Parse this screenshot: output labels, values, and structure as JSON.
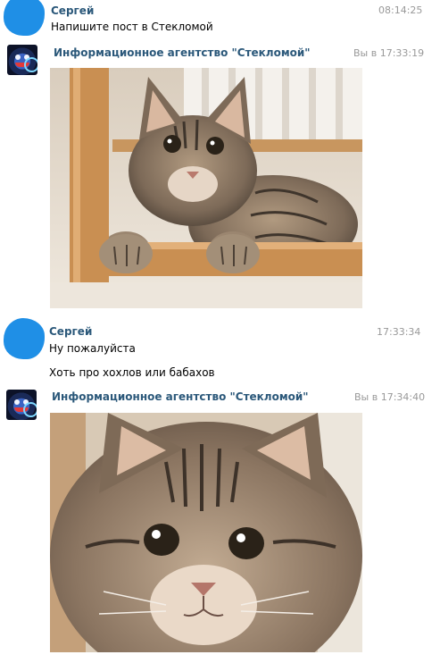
{
  "messages": [
    {
      "author": "Сергей",
      "time": "08:14:25",
      "lines": [
        "Напишите пост в Стекломой"
      ]
    },
    {
      "author": "Информационное агентство \"Стекломой\"",
      "time": "Вы в 17:33:19",
      "attachment": "cat-photo-chair"
    },
    {
      "author": "Сергей",
      "time": "17:33:34",
      "lines": [
        "Ну пожалуйста",
        "Хоть про хохлов или бабахов"
      ]
    },
    {
      "author": "Информационное агентство \"Стекломой\"",
      "time": "Вы в 17:34:40",
      "attachment": "cat-photo-closeup"
    }
  ],
  "colors": {
    "author_link": "#2b587a",
    "timestamp": "#999999",
    "avatar_blob": "#1f8fe6"
  }
}
